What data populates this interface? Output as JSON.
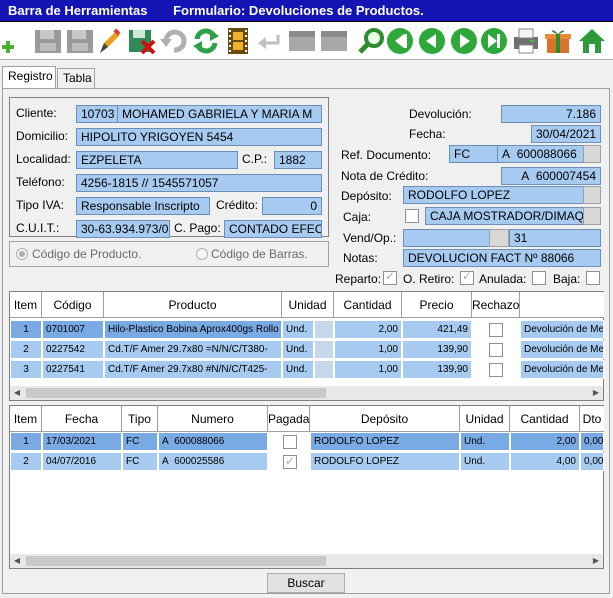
{
  "title": {
    "left": "Barra de Herramientas",
    "form": "Formulario: Devoluciones de Productos."
  },
  "toolbar": [
    "add-icon",
    "save-disabled-icon",
    "save-disabled-icon",
    "edit-icon",
    "save-delete-icon",
    "undo-disabled-icon",
    "refresh-icon",
    "film-icon",
    "back-disabled-icon",
    "block-disabled-icon",
    "block-disabled-icon",
    "search-icon",
    "first-icon",
    "prev-icon",
    "next-icon",
    "last-icon",
    "print-icon",
    "gift-icon",
    "home-icon"
  ],
  "tabs": {
    "registro": "Registro",
    "tabla": "Tabla"
  },
  "customer": {
    "cliente_label": "Cliente:",
    "cliente_code": "10703",
    "cliente_name": "MOHAMED GABRIELA Y MARIA M",
    "domicilio_label": "Domicilio:",
    "domicilio": "HIPOLITO YRIGOYEN 5454",
    "localidad_label": "Localidad:",
    "localidad": "EZPELETA",
    "cp_label": "C.P.:",
    "cp": "1882",
    "telefono_label": "Teléfono:",
    "telefono": "4256-1815 // 1545571057",
    "iva_label": "Tipo IVA:",
    "iva": "Responsable Inscripto",
    "credito_label": "Crédito:",
    "credito": "0",
    "cuit_label": "C.U.I.T.:",
    "cuit": "30-63.934.973/0",
    "cpago_label": "C. Pago:",
    "cpago": "CONTADO EFEC"
  },
  "doc": {
    "devolucion_label": "Devolución:",
    "devolucion": "7.186",
    "fecha_label": "Fecha:",
    "fecha": "30/04/2021",
    "refdoc_label": "Ref. Documento:",
    "refdoc_type": "FC",
    "refdoc_letter": "A",
    "refdoc_num": "600088066",
    "nota_label": "Nota de Crédito:",
    "nota_letter": "A",
    "nota_num": "600007454",
    "deposito_label": "Depósito:",
    "deposito": "RODOLFO LOPEZ",
    "caja_label": "Caja:",
    "caja": "CAJA MOSTRADOR/DIMAQ",
    "vend_label": "Vend/Op.:",
    "vend_num": "31",
    "notas_label": "Notas:",
    "notas": "DEVOLUCION FACT Nº 88066"
  },
  "flags": {
    "reparto": "Reparto:",
    "oretiro": "O. Retiro:",
    "anulada": "Anulada:",
    "baja": "Baja:"
  },
  "radios": {
    "producto": "Código de Producto.",
    "barras": "Código de Barras."
  },
  "grid1": {
    "headers": [
      "Item",
      "Código",
      "Producto",
      "Unidad",
      "Cantidad",
      "Precio",
      "Rechazo",
      ""
    ],
    "rows": [
      {
        "item": "1",
        "codigo": "0701007",
        "producto": "Hilo-Plastico Bobina Aprox400gs Rollo",
        "unidad": "Und.",
        "cantidad": "2,00",
        "precio": "421,49",
        "motivo": "Devolución de Mercadería"
      },
      {
        "item": "2",
        "codigo": "0227542",
        "producto": "Cd.T/F Amer 29.7x80 =N/N/C/T380-",
        "unidad": "Und.",
        "cantidad": "1,00",
        "precio": "139,90",
        "motivo": "Devolución de Mercadería"
      },
      {
        "item": "3",
        "codigo": "0227541",
        "producto": "Cd.T/F Amer 29.7x80 #N/N/C/T425-",
        "unidad": "Und.",
        "cantidad": "1,00",
        "precio": "139,90",
        "motivo": "Devolución de Mercadería"
      }
    ]
  },
  "grid2": {
    "headers": [
      "Item",
      "Fecha",
      "Tipo",
      "Numero",
      "Pagada",
      "Depósito",
      "Unidad",
      "Cantidad",
      "Dto"
    ],
    "rows": [
      {
        "item": "1",
        "fecha": "17/03/2021",
        "tipo": "FC",
        "letra": "A",
        "numero": "600088066",
        "deposito": "RODOLFO LOPEZ",
        "unidad": "Und.",
        "cantidad": "2,00",
        "dto": "0,00"
      },
      {
        "item": "2",
        "fecha": "04/07/2016",
        "tipo": "FC",
        "letra": "A",
        "numero": "600025586",
        "deposito": "RODOLFO LOPEZ",
        "unidad": "Und.",
        "cantidad": "4,00",
        "dto": "0,00"
      }
    ]
  },
  "buscar": "Buscar"
}
